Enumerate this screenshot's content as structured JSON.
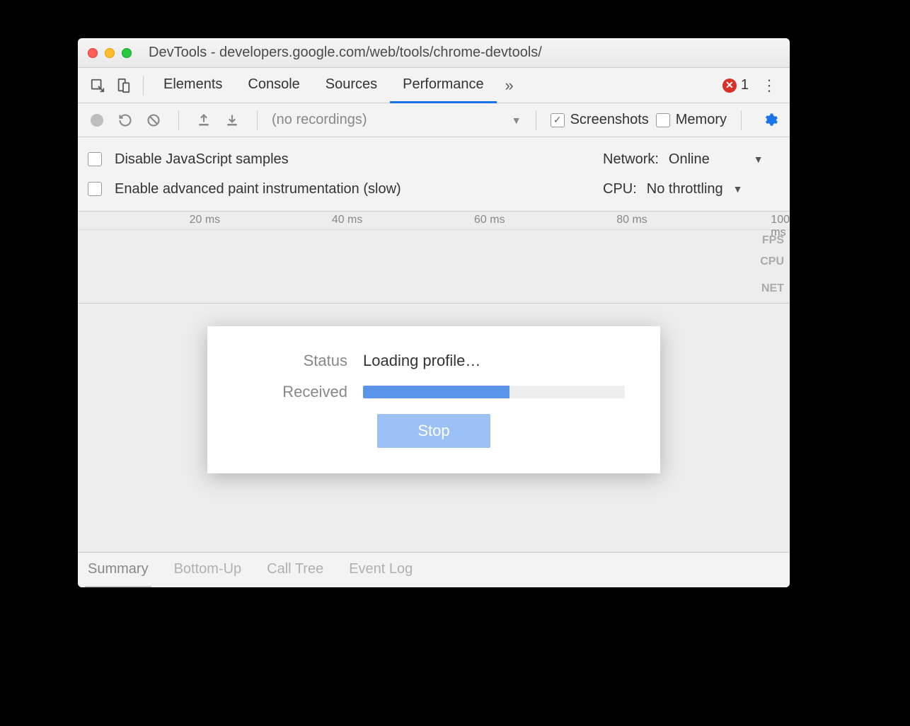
{
  "window": {
    "title": "DevTools - developers.google.com/web/tools/chrome-devtools/"
  },
  "tabs": {
    "elements": "Elements",
    "console": "Console",
    "sources": "Sources",
    "performance": "Performance",
    "error_count": "1"
  },
  "toolbar": {
    "recordings_label": "(no recordings)",
    "screenshots_label": "Screenshots",
    "memory_label": "Memory"
  },
  "settings": {
    "disable_js_label": "Disable JavaScript samples",
    "enable_paint_label": "Enable advanced paint instrumentation (slow)",
    "network_label": "Network:",
    "network_value": "Online",
    "cpu_label": "CPU:",
    "cpu_value": "No throttling"
  },
  "timeline": {
    "ticks": [
      "20 ms",
      "40 ms",
      "60 ms",
      "80 ms",
      "100 ms"
    ],
    "lanes": [
      "FPS",
      "CPU",
      "NET"
    ]
  },
  "modal": {
    "status_label": "Status",
    "status_value": "Loading profile…",
    "received_label": "Received",
    "progress_pct": 56,
    "stop_label": "Stop"
  },
  "bottom_tabs": {
    "summary": "Summary",
    "bottom_up": "Bottom-Up",
    "call_tree": "Call Tree",
    "event_log": "Event Log"
  }
}
